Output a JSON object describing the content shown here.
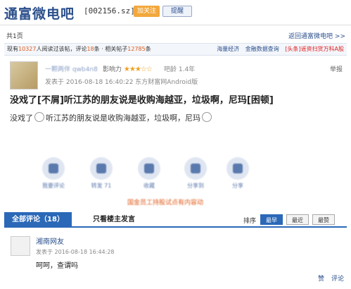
{
  "header": {
    "title": "通富微电吧",
    "code": "[002156.sz]",
    "follow_label": "加关注",
    "remind_label": "提醒"
  },
  "subbar": {
    "pages": "共1页",
    "back_link": "返回通富微电吧 >>"
  },
  "stats": {
    "prefix": "现有",
    "readers": "10327",
    "readers_text": "人阅读过该帖，评论",
    "comments": "18",
    "comments_text": "条 · 相关帖子",
    "related": "12785",
    "related_text": "条",
    "links": [
      "海量经济",
      "金融数据查询",
      "[头条]谣资扫货万科A股"
    ]
  },
  "post": {
    "author": "一颗两伴 qwb4n8",
    "influence_label": "影响力",
    "stars": "★★★☆☆",
    "barage": "吧龄 1.4年",
    "report": "举报",
    "time": "发表于 2016-08-18 16:40:22 东方财富网Android版",
    "title": "没戏了[不屑]听江苏的朋友说是收购海越亚，垃圾啊，尼玛[困顿]",
    "body_1": "没戏了",
    "body_2": "听江苏的朋友说是收购海越亚，垃圾啊，尼玛",
    "actions": [
      "我要评论",
      "转发 71",
      "收藏",
      "分享到",
      "分享"
    ],
    "ad": "国金员工持股试点有内容动"
  },
  "tabs": {
    "all": "全部评论（18）",
    "op_only": "只看楼主发言",
    "sort_label": "排序",
    "sort_options": [
      "最早",
      "最近",
      "最赞"
    ]
  },
  "reply": {
    "name": "湘南网友",
    "time": "发表于 2016-08-18 16:44:28",
    "text": "呵呵，查谓吗",
    "like": "赞",
    "reply": "评论"
  },
  "colors": {
    "brand": "#2b4f8c",
    "tab_active": "#2b68b8",
    "accent_orange": "#f2a83d",
    "highlight_red": "#e02020"
  }
}
